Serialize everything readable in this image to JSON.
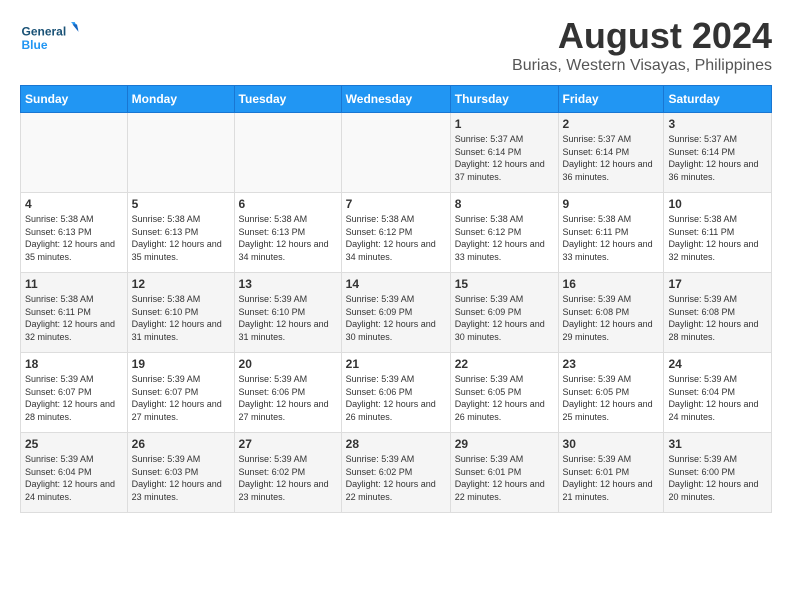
{
  "header": {
    "logo_line1": "General",
    "logo_line2": "Blue",
    "month": "August 2024",
    "location": "Burias, Western Visayas, Philippines"
  },
  "days_of_week": [
    "Sunday",
    "Monday",
    "Tuesday",
    "Wednesday",
    "Thursday",
    "Friday",
    "Saturday"
  ],
  "weeks": [
    [
      {
        "day": "",
        "info": ""
      },
      {
        "day": "",
        "info": ""
      },
      {
        "day": "",
        "info": ""
      },
      {
        "day": "",
        "info": ""
      },
      {
        "day": "1",
        "info": "Sunrise: 5:37 AM\nSunset: 6:14 PM\nDaylight: 12 hours\nand 37 minutes."
      },
      {
        "day": "2",
        "info": "Sunrise: 5:37 AM\nSunset: 6:14 PM\nDaylight: 12 hours\nand 36 minutes."
      },
      {
        "day": "3",
        "info": "Sunrise: 5:37 AM\nSunset: 6:14 PM\nDaylight: 12 hours\nand 36 minutes."
      }
    ],
    [
      {
        "day": "4",
        "info": "Sunrise: 5:38 AM\nSunset: 6:13 PM\nDaylight: 12 hours\nand 35 minutes."
      },
      {
        "day": "5",
        "info": "Sunrise: 5:38 AM\nSunset: 6:13 PM\nDaylight: 12 hours\nand 35 minutes."
      },
      {
        "day": "6",
        "info": "Sunrise: 5:38 AM\nSunset: 6:13 PM\nDaylight: 12 hours\nand 34 minutes."
      },
      {
        "day": "7",
        "info": "Sunrise: 5:38 AM\nSunset: 6:12 PM\nDaylight: 12 hours\nand 34 minutes."
      },
      {
        "day": "8",
        "info": "Sunrise: 5:38 AM\nSunset: 6:12 PM\nDaylight: 12 hours\nand 33 minutes."
      },
      {
        "day": "9",
        "info": "Sunrise: 5:38 AM\nSunset: 6:11 PM\nDaylight: 12 hours\nand 33 minutes."
      },
      {
        "day": "10",
        "info": "Sunrise: 5:38 AM\nSunset: 6:11 PM\nDaylight: 12 hours\nand 32 minutes."
      }
    ],
    [
      {
        "day": "11",
        "info": "Sunrise: 5:38 AM\nSunset: 6:11 PM\nDaylight: 12 hours\nand 32 minutes."
      },
      {
        "day": "12",
        "info": "Sunrise: 5:38 AM\nSunset: 6:10 PM\nDaylight: 12 hours\nand 31 minutes."
      },
      {
        "day": "13",
        "info": "Sunrise: 5:39 AM\nSunset: 6:10 PM\nDaylight: 12 hours\nand 31 minutes."
      },
      {
        "day": "14",
        "info": "Sunrise: 5:39 AM\nSunset: 6:09 PM\nDaylight: 12 hours\nand 30 minutes."
      },
      {
        "day": "15",
        "info": "Sunrise: 5:39 AM\nSunset: 6:09 PM\nDaylight: 12 hours\nand 30 minutes."
      },
      {
        "day": "16",
        "info": "Sunrise: 5:39 AM\nSunset: 6:08 PM\nDaylight: 12 hours\nand 29 minutes."
      },
      {
        "day": "17",
        "info": "Sunrise: 5:39 AM\nSunset: 6:08 PM\nDaylight: 12 hours\nand 28 minutes."
      }
    ],
    [
      {
        "day": "18",
        "info": "Sunrise: 5:39 AM\nSunset: 6:07 PM\nDaylight: 12 hours\nand 28 minutes."
      },
      {
        "day": "19",
        "info": "Sunrise: 5:39 AM\nSunset: 6:07 PM\nDaylight: 12 hours\nand 27 minutes."
      },
      {
        "day": "20",
        "info": "Sunrise: 5:39 AM\nSunset: 6:06 PM\nDaylight: 12 hours\nand 27 minutes."
      },
      {
        "day": "21",
        "info": "Sunrise: 5:39 AM\nSunset: 6:06 PM\nDaylight: 12 hours\nand 26 minutes."
      },
      {
        "day": "22",
        "info": "Sunrise: 5:39 AM\nSunset: 6:05 PM\nDaylight: 12 hours\nand 26 minutes."
      },
      {
        "day": "23",
        "info": "Sunrise: 5:39 AM\nSunset: 6:05 PM\nDaylight: 12 hours\nand 25 minutes."
      },
      {
        "day": "24",
        "info": "Sunrise: 5:39 AM\nSunset: 6:04 PM\nDaylight: 12 hours\nand 24 minutes."
      }
    ],
    [
      {
        "day": "25",
        "info": "Sunrise: 5:39 AM\nSunset: 6:04 PM\nDaylight: 12 hours\nand 24 minutes."
      },
      {
        "day": "26",
        "info": "Sunrise: 5:39 AM\nSunset: 6:03 PM\nDaylight: 12 hours\nand 23 minutes."
      },
      {
        "day": "27",
        "info": "Sunrise: 5:39 AM\nSunset: 6:02 PM\nDaylight: 12 hours\nand 23 minutes."
      },
      {
        "day": "28",
        "info": "Sunrise: 5:39 AM\nSunset: 6:02 PM\nDaylight: 12 hours\nand 22 minutes."
      },
      {
        "day": "29",
        "info": "Sunrise: 5:39 AM\nSunset: 6:01 PM\nDaylight: 12 hours\nand 22 minutes."
      },
      {
        "day": "30",
        "info": "Sunrise: 5:39 AM\nSunset: 6:01 PM\nDaylight: 12 hours\nand 21 minutes."
      },
      {
        "day": "31",
        "info": "Sunrise: 5:39 AM\nSunset: 6:00 PM\nDaylight: 12 hours\nand 20 minutes."
      }
    ]
  ]
}
